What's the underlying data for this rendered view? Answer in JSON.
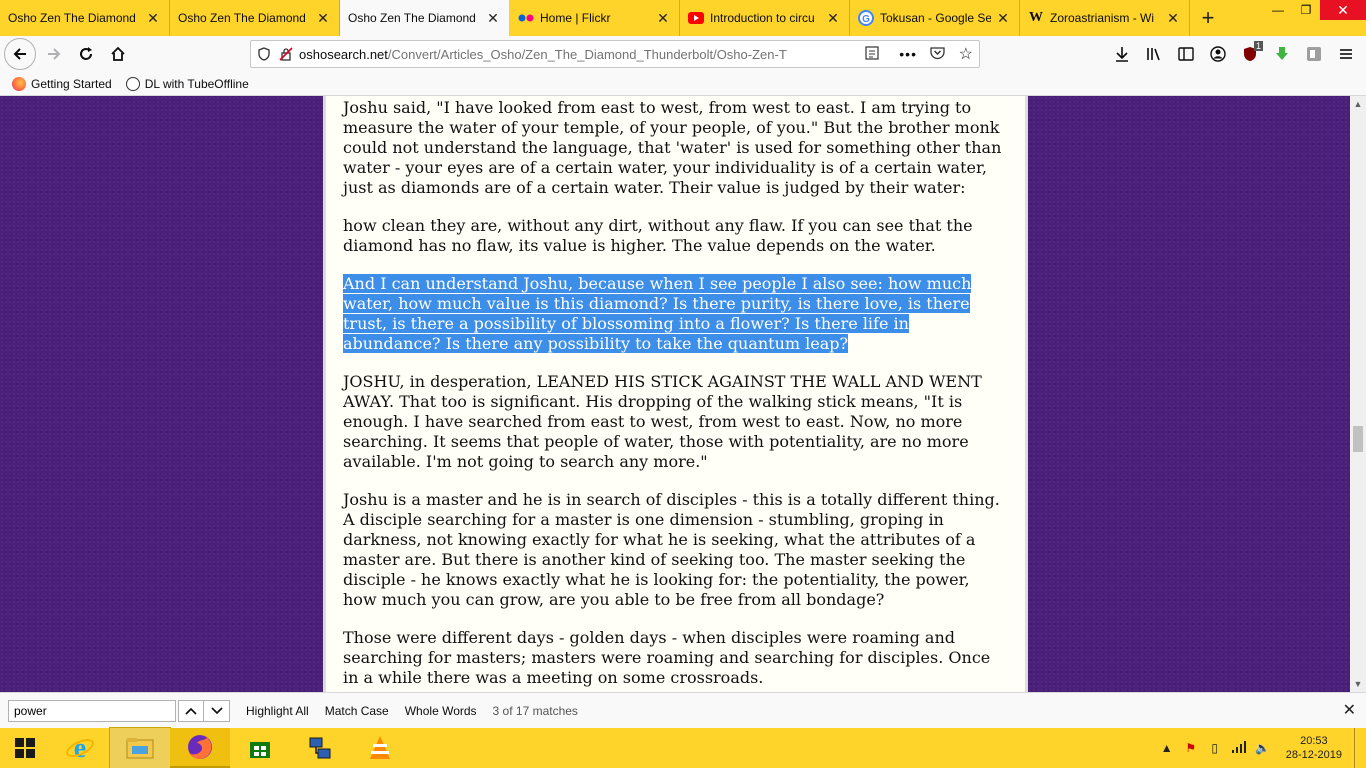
{
  "tabs": [
    {
      "title": "Osho Zen The Diamond",
      "icon": "osho-favicon",
      "active": false
    },
    {
      "title": "Osho Zen The Diamond",
      "icon": "osho-favicon",
      "active": false
    },
    {
      "title": "Osho Zen The Diamond",
      "icon": "osho-favicon",
      "active": true
    },
    {
      "title": "Home | Flickr",
      "icon": "flickr-icon",
      "active": false
    },
    {
      "title": "Introduction to circu",
      "icon": "youtube-icon",
      "active": false
    },
    {
      "title": "Tokusan - Google Se",
      "icon": "google-icon",
      "active": false
    },
    {
      "title": "Zoroastrianism - Wi",
      "icon": "wikipedia-icon",
      "active": false
    }
  ],
  "url": {
    "host": "oshosearch.net",
    "path": "/Convert/Articles_Osho/Zen_The_Diamond_Thunderbolt/Osho-Zen-T"
  },
  "addon_badge": "1",
  "bookmarks": [
    {
      "label": "Getting Started",
      "icon": "firefox-icon"
    },
    {
      "label": "DL with TubeOffline",
      "icon": "globe-icon"
    }
  ],
  "article": {
    "paragraphs": [
      "Joshu said, \"I have looked from east to west, from west to east. I am trying to measure the water of your temple, of your people, of you.\" But the brother monk could not understand the language, that 'water' is used for something other than water - your eyes are of a certain water, your individuality is of a certain water, just as diamonds are of a certain water. Their value is judged by their water:",
      "how clean they are, without any dirt, without any flaw. If you can see that the diamond has no flaw, its value is higher. The value depends on the water.",
      "And I can understand Joshu, because when I see people I also see: how much water, how much value is this diamond? Is there purity, is there love, is there trust, is there a possibility of blossoming into a flower? Is there life in abundance? Is there any possibility to take the quantum leap?",
      "JOSHU, in desperation, LEANED HIS STICK AGAINST THE WALL AND WENT AWAY. That too is significant. His dropping of the walking stick means, \"It is enough. I have searched from east to west, from west to east. Now, no more searching. It seems that people of water, those with potentiality, are no more available. I'm not going to search any more.\"",
      "Joshu is a master and he is in search of disciples - this is a totally different thing. A disciple searching for a master is one dimension - stumbling, groping in darkness, not knowing exactly for what he is seeking, what the attributes of a master are. But there is another kind of seeking too. The master seeking the disciple - he knows exactly what he is looking for: the potentiality, the power, how much you can grow, are you able to be free from all bondage?",
      "Those were different days - golden days - when disciples were roaming and searching for masters; masters were roaming and searching for disciples. Once in a while there was a meeting on some crossroads."
    ],
    "highlighted_paragraph_index": 2
  },
  "findbar": {
    "query": "power",
    "highlight_all": "Highlight All",
    "match_case": "Match Case",
    "whole_words": "Whole Words",
    "status": "3 of 17 matches"
  },
  "taskbar": {
    "items": [
      "start-button",
      "internet-explorer-icon",
      "file-explorer-icon",
      "firefox-icon",
      "store-icon",
      "network-tool-icon",
      "vlc-icon"
    ],
    "clock_time": "20:53",
    "clock_date": "28-12-2019"
  },
  "colors": {
    "tab_strip": "#ffd42a",
    "page_background": "#4a1f7a",
    "selection": "#3d8ee8",
    "article_background": "#fffef7"
  }
}
